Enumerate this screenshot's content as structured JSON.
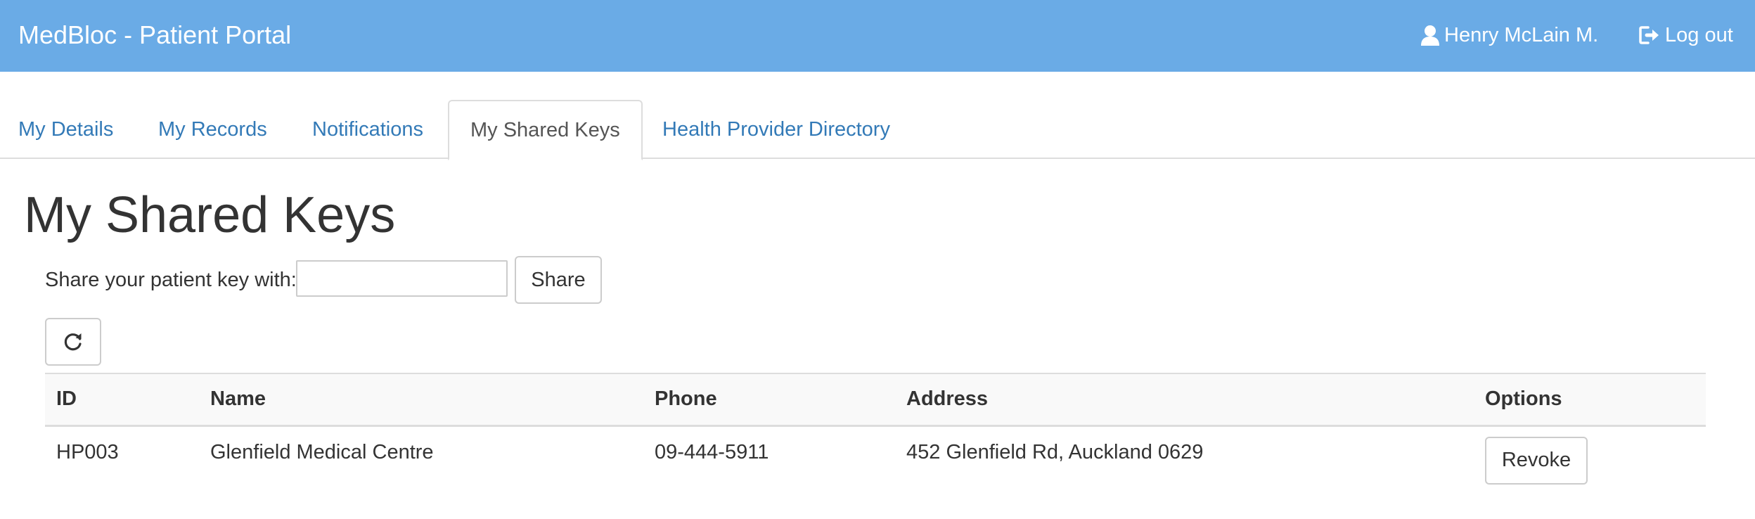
{
  "header": {
    "brand": "MedBloc - Patient Portal",
    "user_name": "Henry McLain M.",
    "logout_label": "Log out",
    "user_icon": "user-icon",
    "logout_icon": "logout-icon",
    "accent_color": "#6aabe6"
  },
  "tabs": [
    {
      "label": "My Details"
    },
    {
      "label": "My Records"
    },
    {
      "label": "Notifications"
    },
    {
      "label": "My Shared Keys",
      "active": true
    },
    {
      "label": "Health Provider Directory"
    }
  ],
  "main": {
    "title": "My Shared Keys",
    "share_label": "Share your patient key with:",
    "share_input_value": "",
    "share_button": "Share",
    "refresh_icon": "refresh-icon"
  },
  "table": {
    "headers": [
      "ID",
      "Name",
      "Phone",
      "Address",
      "Options"
    ],
    "rows": [
      {
        "id": "HP003",
        "name": "Glenfield Medical Centre",
        "phone": "09-444-5911",
        "address": "452 Glenfield Rd, Auckland 0629",
        "option_label": "Revoke"
      }
    ]
  }
}
